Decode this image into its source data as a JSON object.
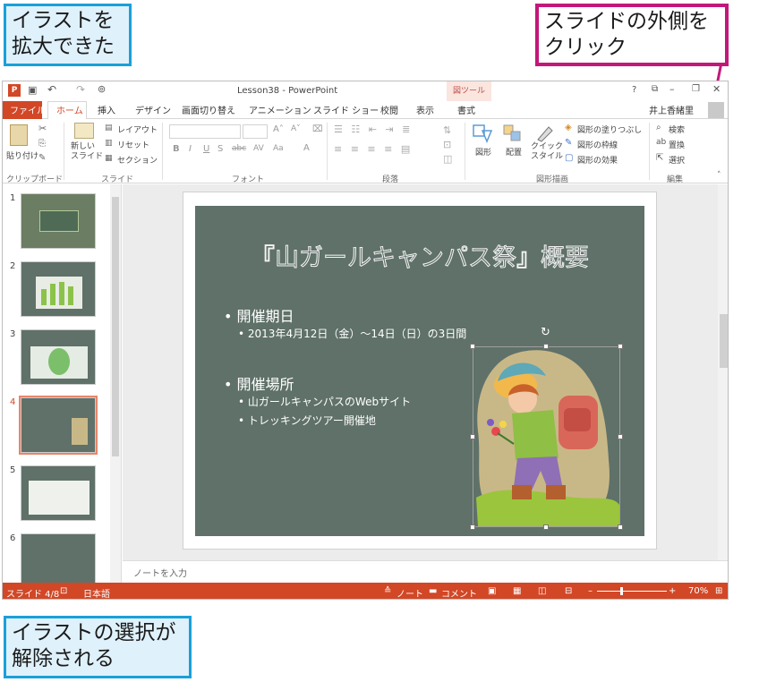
{
  "callouts": {
    "top_left": "イラストを\n拡大できた",
    "top_right": "スライドの外側を\nクリック",
    "bottom_left": "イラストの選択が\n解除される"
  },
  "window": {
    "title": "Lesson38 - PowerPoint",
    "context_tab_group": "図ツール",
    "help": "?",
    "user": "井上香緒里"
  },
  "tabs": [
    "ファイル",
    "ホーム",
    "挿入",
    "デザイン",
    "画面切り替え",
    "アニメーション",
    "スライド ショー",
    "校閲",
    "表示",
    "書式"
  ],
  "ribbon": {
    "paste": "貼り付け",
    "new_slide": "新しい\nスライド",
    "layout": "レイアウト",
    "reset": "リセット",
    "section": "セクション",
    "shape": "図形",
    "arrange": "配置",
    "quick_style": "クイック\nスタイル",
    "shape_fill": "図形の塗りつぶし",
    "shape_outline": "図形の枠線",
    "shape_effects": "図形の効果",
    "find": "検索",
    "replace": "置換",
    "select": "選択",
    "groups": {
      "clipboard": "クリップボード",
      "slides": "スライド",
      "font": "フォント",
      "paragraph": "段落",
      "drawing": "図形描画",
      "editing": "編集"
    }
  },
  "thumbnails": {
    "numbers": [
      "1",
      "2",
      "3",
      "4",
      "5",
      "6"
    ],
    "selected_index": 4
  },
  "slide": {
    "title": "『山ガールキャンパス祭』概要",
    "bullet1": "開催期日",
    "sub1": "2013年4月12日（金）～14日（日）の3日間",
    "bullet2": "開催場所",
    "sub2": "山ガールキャンパスのWebサイト",
    "sub3": "トレッキングツアー開催地"
  },
  "notes_placeholder": "ノートを入力",
  "status": {
    "slide_info": "スライド 4/8",
    "language": "日本語",
    "notes": "ノート",
    "comments": "コメント",
    "zoom": "70%"
  },
  "colors": {
    "accent": "#d24726",
    "slide_bg": "#5f7169",
    "callout_blue": "#1aa0d8",
    "callout_pink": "#c2187a"
  }
}
